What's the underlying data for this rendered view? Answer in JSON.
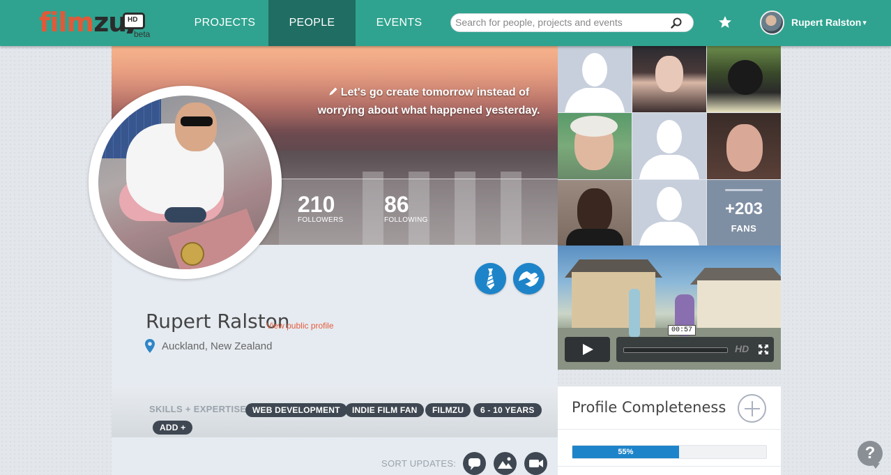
{
  "brand": {
    "logo_text_a": "film",
    "logo_text_b": "zu",
    "logo_badge": "HD",
    "logo_sub": "beta"
  },
  "nav": {
    "items": [
      {
        "label": "PROJECTS",
        "active": false
      },
      {
        "label": "PEOPLE",
        "active": true
      },
      {
        "label": "EVENTS",
        "active": false
      }
    ]
  },
  "search": {
    "placeholder": "Search for people, projects and events",
    "value": ""
  },
  "user": {
    "name": "Rupert Ralston",
    "caret": "▾"
  },
  "profile": {
    "quote": "Let's go create tomorrow instead of worrying about what happened yesterday.",
    "followers": {
      "count": "210",
      "label": "FOLLOWERS"
    },
    "following": {
      "count": "86",
      "label": "FOLLOWING"
    },
    "name": "Rupert Ralston",
    "public_link": "View public profile",
    "location": "Auckland, New Zealand"
  },
  "skills": {
    "label": "SKILLS + EXPERTISE:",
    "tags": [
      "WEB DEVELOPMENT",
      "INDIE FILM FAN",
      "FILMZU",
      "6 - 10 YEARS"
    ],
    "add_label": "ADD +"
  },
  "sort": {
    "label": "SORT UPDATES:"
  },
  "fans": {
    "more_count": "+203",
    "more_label": "FANS"
  },
  "video": {
    "timecode": "00:57",
    "hd": "HD"
  },
  "completeness": {
    "title": "Profile Completeness",
    "percent": 55,
    "percent_label": "55%"
  },
  "help": {
    "label": "?"
  },
  "colors": {
    "brand": "#2fa38f",
    "nav_active": "#1f6d63",
    "accent": "#e45c3c",
    "blue": "#1e84c9",
    "tag": "#3f4852"
  }
}
